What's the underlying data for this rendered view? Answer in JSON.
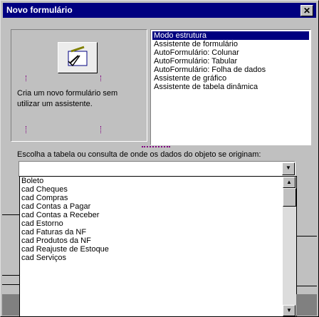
{
  "window": {
    "title": "Novo formulário",
    "close_glyph": "✕"
  },
  "left_panel": {
    "icon": "form-wizard-icon",
    "description": "Cria um novo formulário sem utilizar um assistente."
  },
  "wizard_list": {
    "items": [
      "Modo estrutura",
      "Assistente de formulário",
      "AutoFormulário: Colunar",
      "AutoFormulário: Tabular",
      "AutoFormulário: Folha de dados",
      "Assistente de gráfico",
      "Assistente de tabela dinâmica"
    ],
    "selected": "Modo estrutura"
  },
  "table_prompt": "Escolha a tabela ou consulta de onde os dados do objeto se originam:",
  "table_combo": {
    "value": "",
    "options": [
      "Boleto",
      "cad Cheques",
      "cad Compras",
      "cad Contas a Pagar",
      "cad Contas a Receber",
      "cad Estorno",
      "cad Faturas da NF",
      "cad Produtos da NF",
      "cad Reajuste de Estoque",
      "cad Serviços"
    ]
  }
}
